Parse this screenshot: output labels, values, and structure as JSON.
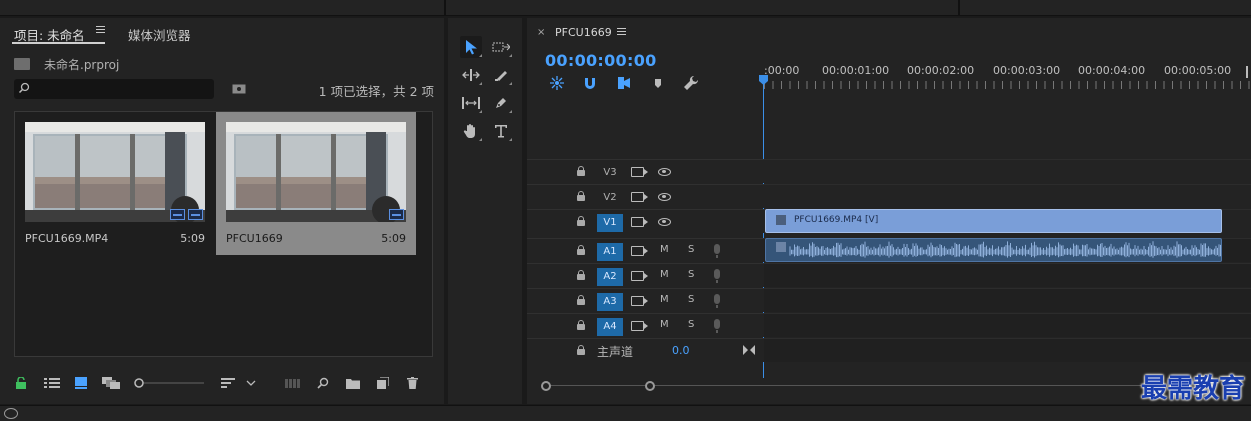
{
  "project_panel": {
    "tabs": [
      {
        "label": "项目: 未命名",
        "active": true
      },
      {
        "label": "媒体浏览器",
        "active": false
      }
    ],
    "project_file": "未命名.prproj",
    "search": {
      "value": "",
      "placeholder": ""
    },
    "selection_info": "1 项已选择，共 2 项",
    "items": [
      {
        "name": "PFCU1669.MP4",
        "duration": "5:09",
        "selected": false
      },
      {
        "name": "PFCU1669",
        "duration": "5:09",
        "selected": true
      }
    ]
  },
  "timeline": {
    "sequence_name": "PFCU1669",
    "close_glyph": "×",
    "timecode": "00:00:00:00",
    "ruler_labels": [
      ":00:00",
      "00:00:01:00",
      "00:00:02:00",
      "00:00:03:00",
      "00:00:04:00",
      "00:00:05:00"
    ],
    "video_tracks": [
      "V3",
      "V2",
      "V1"
    ],
    "audio_tracks": [
      "A1",
      "A2",
      "A3",
      "A4"
    ],
    "mute_label": "M",
    "solo_label": "S",
    "master": {
      "label": "主声道",
      "value": "0.0"
    },
    "video_clip_label": "PFCU1669.MP4 [V]"
  },
  "watermark": "最需教育",
  "colors": {
    "accent": "#4aa2ff",
    "track_selected": "#1e6aa8",
    "video_clip": "#7a9ed8",
    "audio_clip": "#355579"
  }
}
